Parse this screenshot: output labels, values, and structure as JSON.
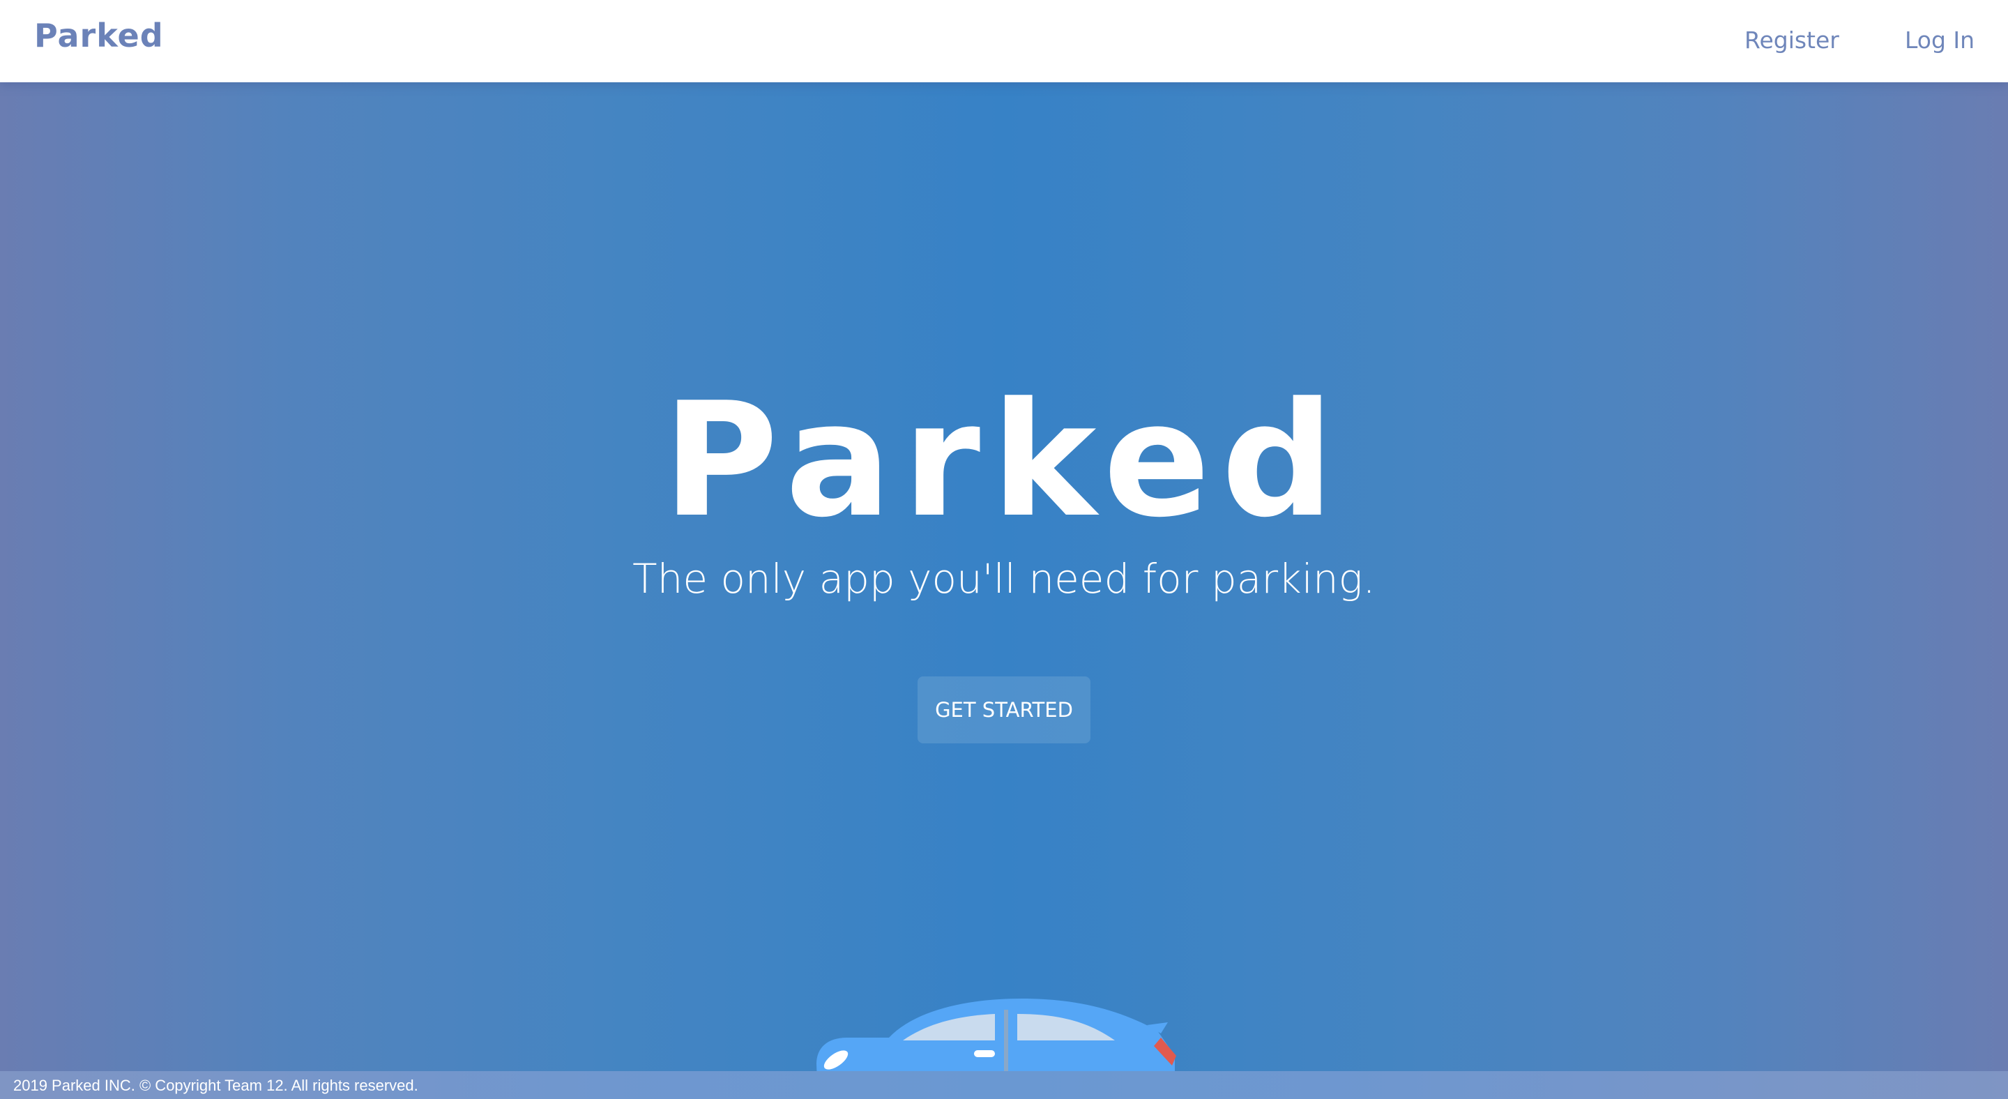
{
  "navbar": {
    "brand": "Parked",
    "links": {
      "register": "Register",
      "login": "Log In"
    }
  },
  "hero": {
    "title": "Parked",
    "subtitle": "The only app you'll need for parking.",
    "cta_label": "GET STARTED",
    "illustration": "car-icon"
  },
  "footer": {
    "copyright": "2019 Parked INC. © Copyright Team 12. All rights reserved."
  },
  "colors": {
    "brand": "#6b82b8",
    "hero_center": "#3782c6",
    "hero_edge": "#6a7db2",
    "car_body": "#55a6f6",
    "car_stripe": "#2a6ee8",
    "tail_light": "#e15a4e"
  }
}
